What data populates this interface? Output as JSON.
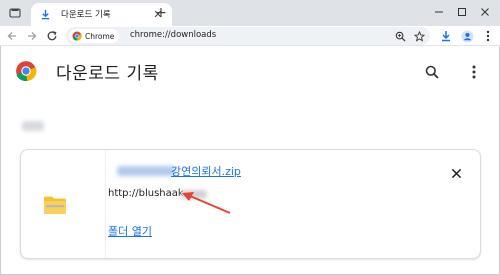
{
  "tab": {
    "title": "다운로드 기록",
    "close_glyph": "✕",
    "new_tab_glyph": "+"
  },
  "omnibox": {
    "chip_label": "Chrome",
    "url": "chrome://downloads"
  },
  "page": {
    "title": "다운로드 기록"
  },
  "download": {
    "file_name": "강연의뢰서.zip",
    "source_url": "http://blushaak",
    "open_folder_label": "폴더 열기"
  },
  "colors": {
    "accent": "#1a73e8",
    "annotation_arrow": "#e5452f",
    "folder": "#f4c430"
  }
}
